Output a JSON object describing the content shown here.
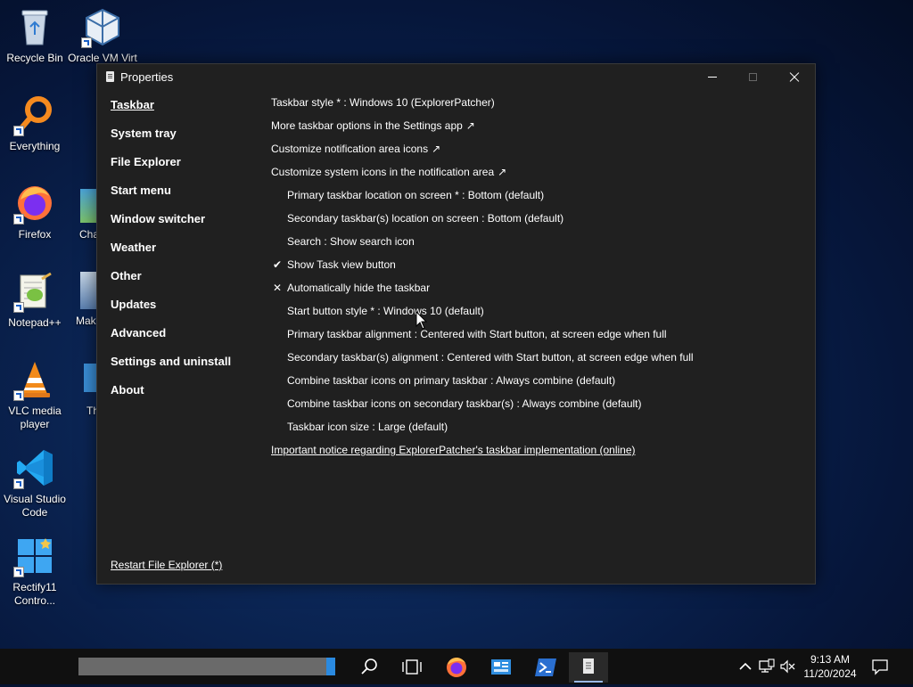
{
  "desktop": {
    "icons": [
      {
        "label": "Recycle Bin",
        "icon": "recycle-bin-icon"
      },
      {
        "label": "Oracle VM Virt",
        "icon": "virtualbox-icon"
      },
      {
        "label": "Everything",
        "icon": "everything-search-icon"
      },
      {
        "label": "Firefox",
        "icon": "firefox-icon"
      },
      {
        "label": "Notepad++",
        "icon": "notepad-plus-plus-icon"
      },
      {
        "label": "VLC media player",
        "icon": "vlc-icon"
      },
      {
        "label": "Visual Studio Code",
        "icon": "vscode-icon"
      },
      {
        "label": "Rectify11 Contro...",
        "icon": "rectify11-icon"
      },
      {
        "label": "Cha",
        "icon": "partial-app-icon"
      },
      {
        "label": "Mak",
        "icon": "partial-app-icon"
      },
      {
        "label": "Th",
        "icon": "partial-app-icon"
      }
    ]
  },
  "window": {
    "title": "Properties",
    "nav": [
      "Taskbar",
      "System tray",
      "File Explorer",
      "Start menu",
      "Window switcher",
      "Weather",
      "Other",
      "Updates",
      "Advanced",
      "Settings and uninstall",
      "About"
    ],
    "active_nav": "Taskbar",
    "options": [
      {
        "text": "Taskbar style * : Windows 10 (ExplorerPatcher)",
        "indent": false,
        "mark": "",
        "arrow": ""
      },
      {
        "text": "More taskbar options in the Settings app",
        "indent": false,
        "mark": "",
        "arrow": "↗"
      },
      {
        "text": "Customize notification area icons",
        "indent": false,
        "mark": "",
        "arrow": "↗"
      },
      {
        "text": "Customize system icons in the notification area",
        "indent": false,
        "mark": "",
        "arrow": "↗"
      },
      {
        "text": "Primary taskbar location on screen * : Bottom (default)",
        "indent": true,
        "mark": "",
        "arrow": ""
      },
      {
        "text": "Secondary taskbar(s) location on screen : Bottom (default)",
        "indent": true,
        "mark": "",
        "arrow": ""
      },
      {
        "text": "Search : Show search icon",
        "indent": true,
        "mark": "",
        "arrow": ""
      },
      {
        "text": "Show Task view button",
        "indent": true,
        "mark": "✔",
        "arrow": ""
      },
      {
        "text": "Automatically hide the taskbar",
        "indent": true,
        "mark": "✕",
        "arrow": ""
      },
      {
        "text": "Start button style * : Windows 10 (default)",
        "indent": true,
        "mark": "",
        "arrow": ""
      },
      {
        "text": "Primary taskbar alignment : Centered with Start button, at screen edge when full",
        "indent": true,
        "mark": "",
        "arrow": ""
      },
      {
        "text": "Secondary taskbar(s) alignment : Centered with Start button, at screen edge when full",
        "indent": true,
        "mark": "",
        "arrow": ""
      },
      {
        "text": "Combine taskbar icons on primary taskbar : Always combine (default)",
        "indent": true,
        "mark": "",
        "arrow": ""
      },
      {
        "text": "Combine taskbar icons on secondary taskbar(s) : Always combine (default)",
        "indent": true,
        "mark": "",
        "arrow": ""
      },
      {
        "text": "Taskbar icon size : Large (default)",
        "indent": true,
        "mark": "",
        "arrow": ""
      }
    ],
    "notice_link": "Important notice regarding ExplorerPatcher's taskbar implementation (online)",
    "restart_link": "Restart File Explorer (*)"
  },
  "taskbar": {
    "apps": [
      "search-icon",
      "task-view-icon",
      "firefox-icon",
      "control-panel-icon",
      "powershell-icon",
      "properties-app-icon"
    ],
    "tray": [
      "chevron-up-icon",
      "network-icon",
      "volume-muted-icon",
      "notification-icon"
    ],
    "time": "9:13 AM",
    "date": "11/20/2024"
  },
  "colors": {
    "window_bg": "#202020",
    "accent": "#2a8ae0"
  }
}
